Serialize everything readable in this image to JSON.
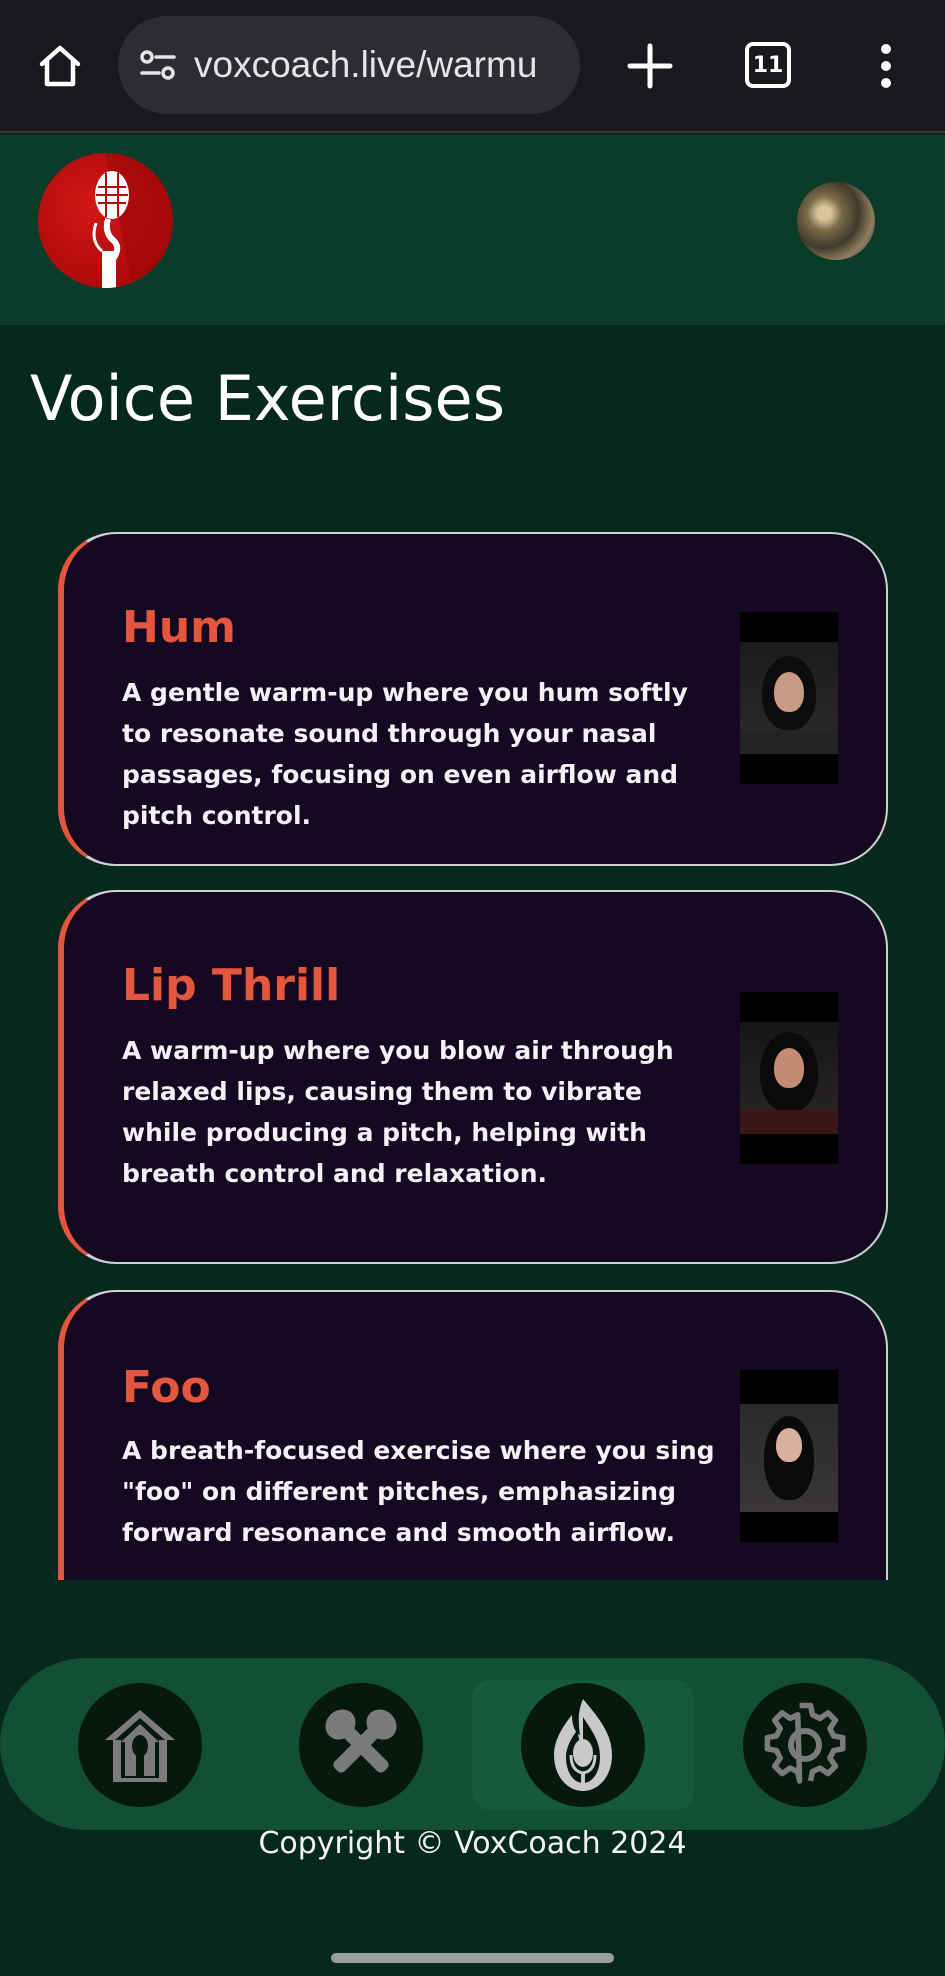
{
  "browser": {
    "url": "voxcoach.live/warmu",
    "tab_count": "11"
  },
  "header": {
    "logo_icon": "microphone-icon",
    "avatar_icon": "user-avatar"
  },
  "page": {
    "title": "Voice Exercises"
  },
  "exercises": [
    {
      "title": "Hum",
      "description": "A gentle warm-up where you hum softly to resonate sound through your nasal passages, focusing on even airflow and pitch control."
    },
    {
      "title": "Lip Thrill",
      "description": "A warm-up where you blow air through relaxed lips, causing them to vibrate while producing a pitch, helping with breath control and relaxation."
    },
    {
      "title": "Foo",
      "description": "A breath-focused exercise where you sing \"foo\" on different pitches, emphasizing forward resonance and smooth airflow."
    }
  ],
  "nav": {
    "items": [
      {
        "icon": "home-mic-icon",
        "active": false
      },
      {
        "icon": "crossed-mics-icon",
        "active": false
      },
      {
        "icon": "flame-mic-icon",
        "active": true
      },
      {
        "icon": "gear-icon",
        "active": false
      }
    ]
  },
  "footer": {
    "copyright": "Copyright © VoxCoach 2024"
  },
  "colors": {
    "accent": "#e4563d",
    "card_bg": "#150821",
    "page_bg": "#07291d",
    "header_bg": "#0b3b29",
    "nav_bg": "#134e37"
  }
}
